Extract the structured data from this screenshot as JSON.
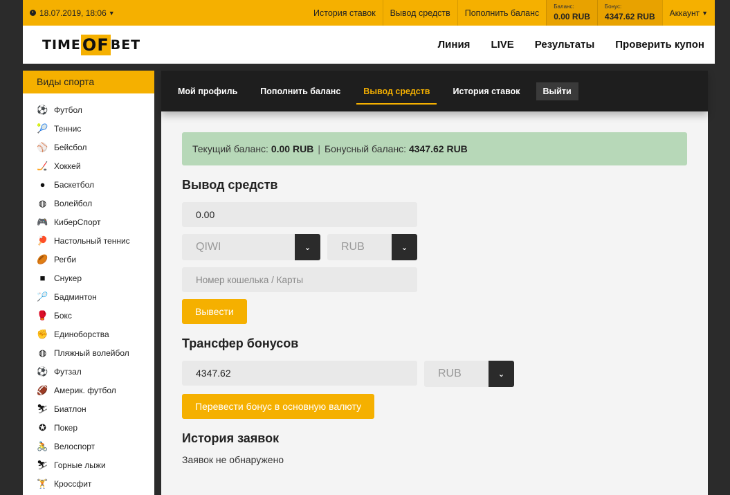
{
  "topbar": {
    "datetime": "18.07.2019, 18:06",
    "links": [
      "История ставок",
      "Вывод средств",
      "Пополнить баланс"
    ],
    "balance_label": "Баланс:",
    "balance_value": "0.00 RUB",
    "bonus_label": "Бонус:",
    "bonus_value": "4347.62 RUB",
    "account_label": "Аккаунт"
  },
  "header": {
    "logo": {
      "part1": "TIME",
      "part2": "OF",
      "part3": "BET"
    },
    "nav": [
      "Линия",
      "LIVE",
      "Результаты",
      "Проверить купон"
    ]
  },
  "sidebar": {
    "title": "Виды спорта",
    "items": [
      {
        "label": "Футбол",
        "icon": "soccer-ball-icon",
        "glyph": "⚽"
      },
      {
        "label": "Теннис",
        "icon": "tennis-racket-icon",
        "glyph": "🎾"
      },
      {
        "label": "Бейсбол",
        "icon": "baseball-glove-icon",
        "glyph": "⚾"
      },
      {
        "label": "Хоккей",
        "icon": "hockey-stick-icon",
        "glyph": "🏒"
      },
      {
        "label": "Баскетбол",
        "icon": "basketball-icon",
        "glyph": "●"
      },
      {
        "label": "Волейбол",
        "icon": "volleyball-icon",
        "glyph": "◍"
      },
      {
        "label": "КиберСпорт",
        "icon": "gamepad-icon",
        "glyph": "🎮"
      },
      {
        "label": "Настольный теннис",
        "icon": "ping-pong-icon",
        "glyph": "🏓"
      },
      {
        "label": "Регби",
        "icon": "rugby-ball-icon",
        "glyph": "🏉"
      },
      {
        "label": "Снукер",
        "icon": "snooker-icon",
        "glyph": "■"
      },
      {
        "label": "Бадминтон",
        "icon": "shuttlecock-icon",
        "glyph": "🏸"
      },
      {
        "label": "Бокс",
        "icon": "boxing-glove-icon",
        "glyph": "🥊"
      },
      {
        "label": "Единоборства",
        "icon": "martial-arts-icon",
        "glyph": "✊"
      },
      {
        "label": "Пляжный волейбол",
        "icon": "beach-volleyball-icon",
        "glyph": "◍"
      },
      {
        "label": "Футзал",
        "icon": "futsal-ball-icon",
        "glyph": "⚽"
      },
      {
        "label": "Америк. футбол",
        "icon": "american-football-icon",
        "glyph": "🏈"
      },
      {
        "label": "Биатлон",
        "icon": "biathlon-icon",
        "glyph": "⛷"
      },
      {
        "label": "Покер",
        "icon": "poker-chip-icon",
        "glyph": "✪"
      },
      {
        "label": "Велоспорт",
        "icon": "bicycle-icon",
        "glyph": "🚴"
      },
      {
        "label": "Горные лыжи",
        "icon": "skiing-icon",
        "glyph": "⛷"
      },
      {
        "label": "Кроссфит",
        "icon": "crossfit-icon",
        "glyph": "🏋"
      }
    ]
  },
  "tabs": {
    "items": [
      "Мой профиль",
      "Пополнить баланс",
      "Вывод средств",
      "История ставок"
    ],
    "active": "Вывод средств",
    "logout": "Выйти"
  },
  "balance_info": {
    "current_label": "Текущий баланс:",
    "current_value": "0.00 RUB",
    "separator": "|",
    "bonus_label": "Бонусный баланс:",
    "bonus_value": "4347.62 RUB"
  },
  "withdraw": {
    "title": "Вывод средств",
    "amount": "0.00",
    "method": "QIWI",
    "currency": "RUB",
    "wallet_placeholder": "Номер кошелька / Карты",
    "submit": "Вывести"
  },
  "transfer": {
    "title": "Трансфер бонусов",
    "amount": "4347.62",
    "currency": "RUB",
    "submit": "Перевести бонус в основную валюту"
  },
  "history": {
    "title": "История заявок",
    "empty": "Заявок не обнаружено"
  }
}
